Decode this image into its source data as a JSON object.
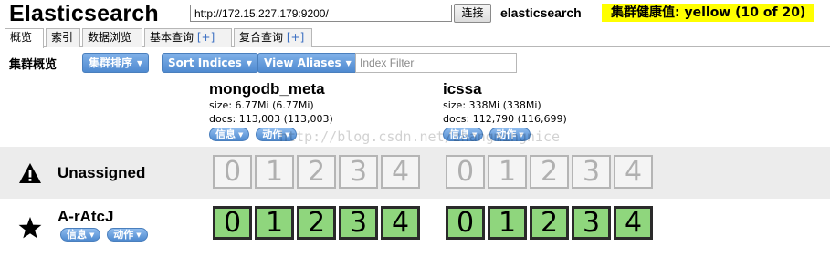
{
  "header": {
    "app_title": "Elasticsearch",
    "url": "http://172.15.227.179:9200/",
    "connect_label": "连接",
    "cluster_name": "elasticsearch",
    "health_label": "集群健康值: yellow (10 of 20)",
    "health_color": "#ffff00"
  },
  "tabs": [
    {
      "label": "概览",
      "plus": ""
    },
    {
      "label": "索引",
      "plus": ""
    },
    {
      "label": "数据浏览",
      "plus": ""
    },
    {
      "label": "基本查询",
      "plus": "[+]"
    },
    {
      "label": "复合查询",
      "plus": "[+]"
    }
  ],
  "toolbar": {
    "title": "集群概览",
    "sort_cluster_label": "集群排序",
    "sort_indices_label": "Sort Indices",
    "view_aliases_label": "View Aliases",
    "index_filter_placeholder": "Index Filter",
    "button_color": "#4f8ad0"
  },
  "indices": [
    {
      "name": "mongodb_meta",
      "size": "size: 6.77Mi (6.77Mi)",
      "docs": "docs: 113,003 (113,003)",
      "info_label": "信息",
      "action_label": "动作"
    },
    {
      "name": "icssa",
      "size": "size: 338Mi (338Mi)",
      "docs": "docs: 112,790 (116,699)",
      "info_label": "信息",
      "action_label": "动作"
    }
  ],
  "watermark": "http://blog.csdn.net/zhangmingnice",
  "nodes": [
    {
      "name": "Unassigned",
      "icon": "warning-icon",
      "state": "unassigned",
      "shards": [
        [
          "0",
          "1",
          "2",
          "3",
          "4"
        ],
        [
          "0",
          "1",
          "2",
          "3",
          "4"
        ]
      ]
    },
    {
      "name": "A-rAtcJ",
      "icon": "star-icon",
      "state": "started",
      "info_label": "信息",
      "action_label": "动作",
      "shards": [
        [
          "0",
          "1",
          "2",
          "3",
          "4"
        ],
        [
          "0",
          "1",
          "2",
          "3",
          "4"
        ]
      ]
    }
  ],
  "colors": {
    "unassigned_shard": "#f4f4f4",
    "started_shard": "#8fd67d",
    "unassigned_row": "#ececec"
  }
}
